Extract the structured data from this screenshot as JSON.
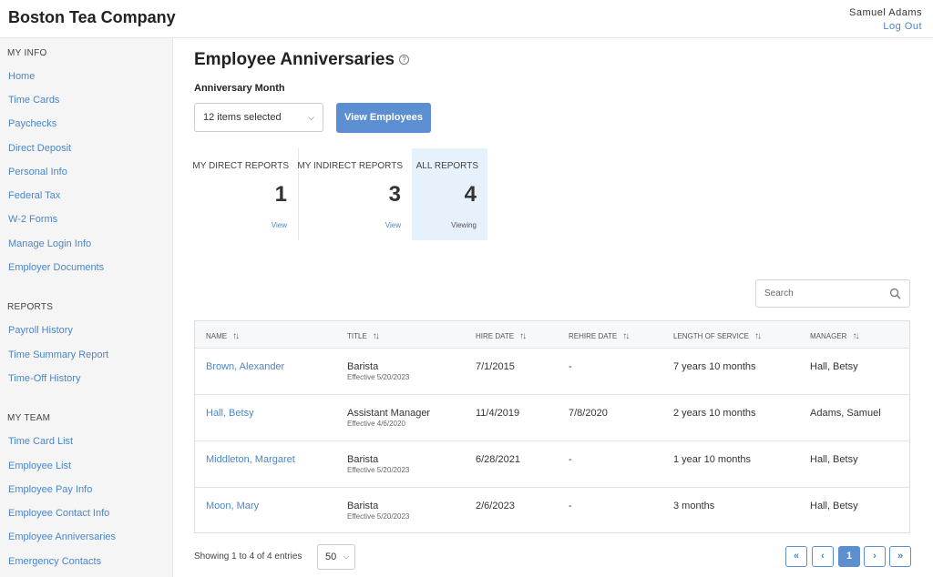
{
  "header": {
    "brand": "Boston Tea Company",
    "user_name": "Samuel Adams",
    "logout": "Log Out"
  },
  "sidebar": {
    "my_info": {
      "heading": "MY INFO",
      "items": [
        "Home",
        "Time Cards",
        "Paychecks",
        "Direct Deposit",
        "Personal Info",
        "Federal Tax",
        "W-2 Forms",
        "Manage Login Info",
        "Employer Documents"
      ]
    },
    "reports": {
      "heading": "REPORTS",
      "items": [
        "Payroll History",
        "Time Summary Report",
        "Time-Off History"
      ]
    },
    "my_team": {
      "heading": "MY TEAM",
      "items": [
        "Time Card List",
        "Employee List",
        "Employee Pay Info",
        "Employee Contact Info",
        "Employee Anniversaries",
        "Emergency Contacts"
      ]
    }
  },
  "page": {
    "title": "Employee Anniversaries",
    "help_glyph": "?",
    "field_label": "Anniversary Month",
    "month_select": "12 items selected",
    "view_button": "View Employees"
  },
  "tiles": [
    {
      "label": "MY DIRECT REPORTS",
      "count": "1",
      "link": "View"
    },
    {
      "label": "MY INDIRECT REPORTS",
      "count": "3",
      "link": "View"
    },
    {
      "label": "ALL REPORTS",
      "count": "4",
      "link": "Viewing"
    }
  ],
  "search": {
    "placeholder": "Search"
  },
  "table": {
    "columns": [
      "NAME",
      "TITLE",
      "HIRE DATE",
      "REHIRE DATE",
      "LENGTH OF SERVICE",
      "MANAGER"
    ],
    "rows": [
      {
        "name": "Brown, Alexander",
        "title": "Barista",
        "effective": "Effective 5/20/2023",
        "hire": "7/1/2015",
        "rehire": "-",
        "service": "7 years 10 months",
        "manager": "Hall, Betsy"
      },
      {
        "name": "Hall, Betsy",
        "title": "Assistant Manager",
        "effective": "Effective 4/6/2020",
        "hire": "11/4/2019",
        "rehire": "7/8/2020",
        "service": "2 years 10 months",
        "manager": "Adams, Samuel"
      },
      {
        "name": "Middleton, Margaret",
        "title": "Barista",
        "effective": "Effective 5/20/2023",
        "hire": "6/28/2021",
        "rehire": "-",
        "service": "1 year 10 months",
        "manager": "Hall, Betsy"
      },
      {
        "name": "Moon, Mary",
        "title": "Barista",
        "effective": "Effective 5/20/2023",
        "hire": "2/6/2023",
        "rehire": "-",
        "service": "3 months",
        "manager": "Hall, Betsy"
      }
    ]
  },
  "footer": {
    "info": "Showing 1 to 4 of 4 entries",
    "page_size": "50",
    "pager": {
      "first": "«",
      "prev": "‹",
      "current": "1",
      "next": "›",
      "last": "»"
    }
  }
}
